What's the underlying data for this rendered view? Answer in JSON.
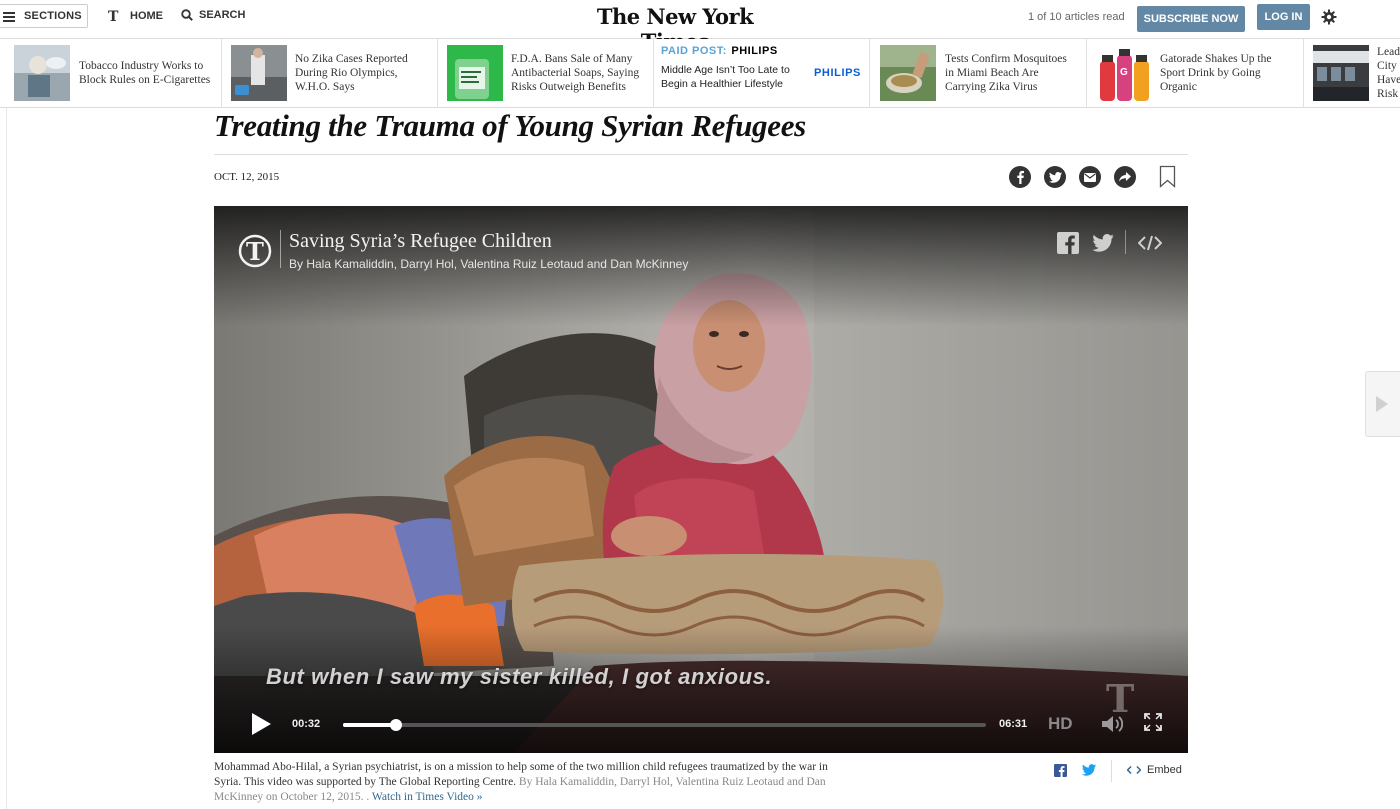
{
  "header": {
    "sections_label": "SECTIONS",
    "home_label": "HOME",
    "search_label": "SEARCH",
    "masthead": "The New York Times",
    "articles_read": "1 of 10 articles read",
    "subscribe_label": "SUBSCRIBE NOW",
    "login_label": "LOG IN"
  },
  "ribbon": {
    "items": [
      {
        "headline": "Tobacco Industry Works to Block Rules on E-Cigarettes"
      },
      {
        "headline": "No Zika Cases Reported During Rio Olympics, W.H.O. Says"
      },
      {
        "headline": "F.D.A. Bans Sale of Many Antibacterial Soaps, Saying Risks Outweigh Benefits"
      },
      {
        "paid_label": "PAID POST:",
        "brand": "PHILIPS",
        "headline": "Middle Age Isn’t Too Late to Begin a Healthier Lifestyle",
        "logo": "PHILIPS"
      },
      {
        "headline": "Tests Confirm Mosquitoes in Miami Beach Are Carrying Zika Virus"
      },
      {
        "headline": "Gatorade Shakes Up the Sport Drink by Going Organic"
      },
      {
        "headline": "Lead City Have Risk"
      }
    ]
  },
  "article": {
    "headline": "Treating the Trauma of Young Syrian Refugees",
    "date": "OCT. 12, 2015"
  },
  "video": {
    "title": "Saving Syria’s Refugee Children",
    "byline": "By Hala Kamaliddin, Darryl Hol, Valentina Ruiz Leotaud and Dan McKinney",
    "subtitle": "But when I saw my sister killed, I got anxious.",
    "current_time": "00:32",
    "total_time": "06:31",
    "hd_label": "HD",
    "progress": 0.082,
    "buffered": 0.087
  },
  "caption": {
    "text": "Mohammad Abo-Hilal, a Syrian psychiatrist, is on a mission to help some of the two million child refugees traumatized by the war in Syria. This video was supported by The Global Reporting Centre.",
    "credit": "By Hala Kamaliddin, Darryl Hol, Valentina Ruiz Leotaud and Dan McKinney on October 12, 2015. .",
    "watch_link": "Watch in Times Video »",
    "embed_label": "Embed"
  },
  "colors": {
    "subscribe_bg": "#6288a5",
    "link": "#326891",
    "paid_post": "#5aa3d6"
  }
}
